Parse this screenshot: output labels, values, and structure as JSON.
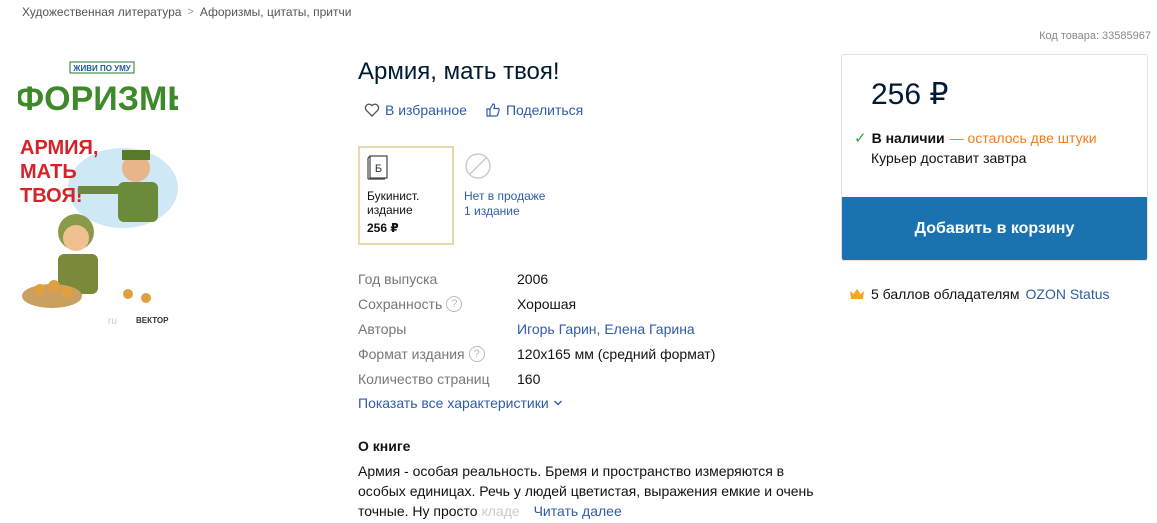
{
  "breadcrumb": [
    "Художественная литература",
    "Афоризмы, цитаты, притчи"
  ],
  "breadcrumb_sep": ">",
  "sku": "Код товара: 33585967",
  "cover": {
    "series": "ЖИВИ ПО УМУ",
    "heading": "АФОРИЗМЫ",
    "subtitle_lines": [
      "АРМИЯ,",
      "МАТЬ",
      "ТВОЯ!"
    ],
    "publisher": "ВЕКТОР",
    "watermark": "ru"
  },
  "product": {
    "title": "Армия, мать твоя!",
    "favorite": "В избранное",
    "share": "Поделиться"
  },
  "editions": {
    "current": {
      "icon_letter": "Б",
      "label_line1": "Букинист.",
      "label_line2": "издание",
      "price": "256 ₽"
    },
    "alt": {
      "label_line1": "Нет в продаже",
      "label_line2": "1 издание"
    }
  },
  "characteristics": [
    {
      "key": "Год выпуска",
      "value": "2006",
      "help": false,
      "link": false
    },
    {
      "key": "Сохранность",
      "value": "Хорошая",
      "help": true,
      "link": false
    },
    {
      "key": "Авторы",
      "value": "Игорь Гарин, Елена Гарина",
      "help": false,
      "link": true
    },
    {
      "key": "Формат издания",
      "value": "120x165 мм (средний формат)",
      "help": true,
      "link": false
    },
    {
      "key": "Количество страниц",
      "value": "160",
      "help": false,
      "link": false
    }
  ],
  "help_glyph": "?",
  "show_all": "Показать все характеристики",
  "about": {
    "heading": "О книге",
    "text": "Армия - особая реальность. Бремя и пространство измеряются в особых единицах. Речь у людей цветистая, выражения емкие и очень точные. Ну просто",
    "faded": "кладе",
    "more": "Читать далее"
  },
  "buy": {
    "price": "256 ₽",
    "in_stock": "В наличии",
    "left": "— осталось две штуки",
    "delivery": "Курьер доставит завтра",
    "cart": "Добавить в корзину"
  },
  "status": {
    "text": "5 баллов обладателям",
    "link": "OZON Status"
  },
  "colors": {
    "accent": "#1a73b0",
    "link": "#2f5ca8",
    "orange": "#f27a1a",
    "green": "#2fa84f"
  }
}
